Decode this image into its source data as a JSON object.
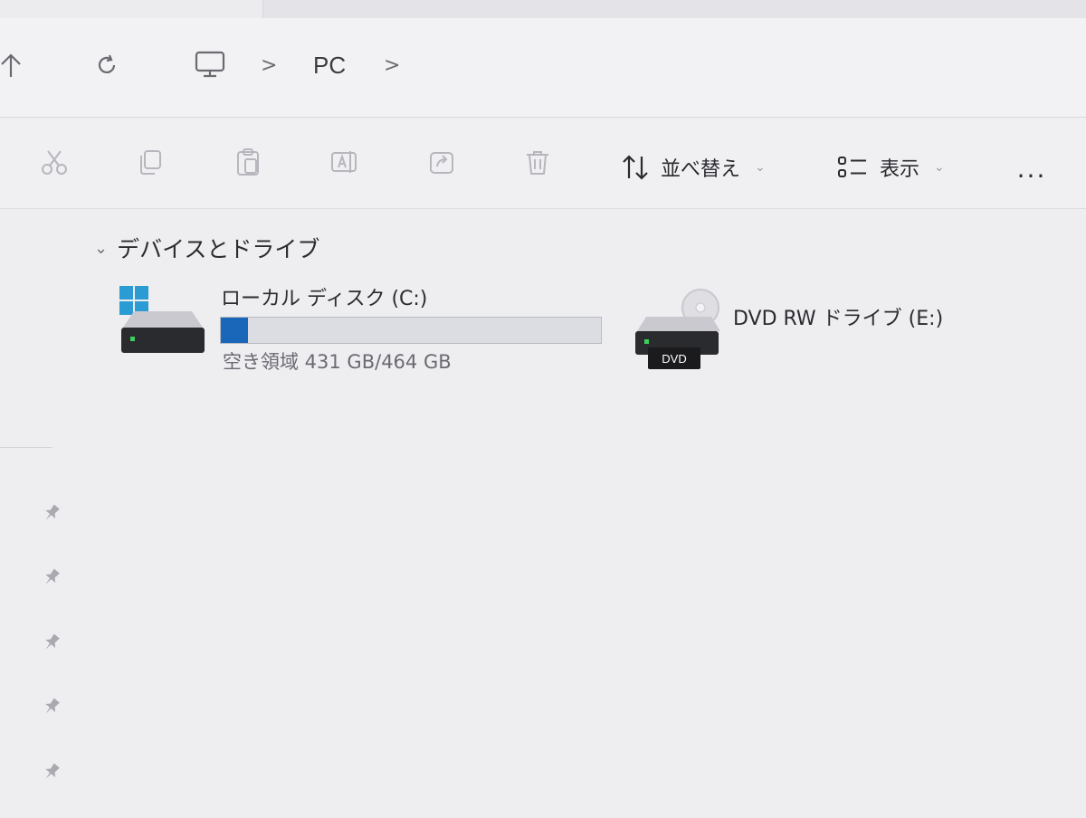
{
  "address_bar": {
    "crumbs": [
      "PC"
    ],
    "separator": ">",
    "icons": [
      "arrow-up-icon",
      "refresh-icon",
      "this-pc-icon"
    ]
  },
  "command_bar": {
    "sort_label": "並べ替え",
    "view_label": "表示",
    "more_label": "...",
    "icons": [
      "cut-icon",
      "copy-icon",
      "paste-icon",
      "rename-icon",
      "share-icon",
      "delete-icon",
      "sort-icon",
      "view-icon"
    ]
  },
  "group": {
    "title": "デバイスとドライブ"
  },
  "drives": [
    {
      "name": "ローカル ディスク (C:)",
      "space_text": "空き領域 431 GB/464 GB",
      "free_gb": 431,
      "total_gb": 464,
      "used_fraction": 0.071,
      "bar_color": "#1a66b8"
    },
    {
      "name": "DVD RW ドライブ (E:)",
      "badge": "DVD"
    }
  ],
  "sidebar": {
    "pinned_count": 5
  },
  "colors": {
    "accent": "#1a66b8",
    "background": "#eeeef1"
  }
}
